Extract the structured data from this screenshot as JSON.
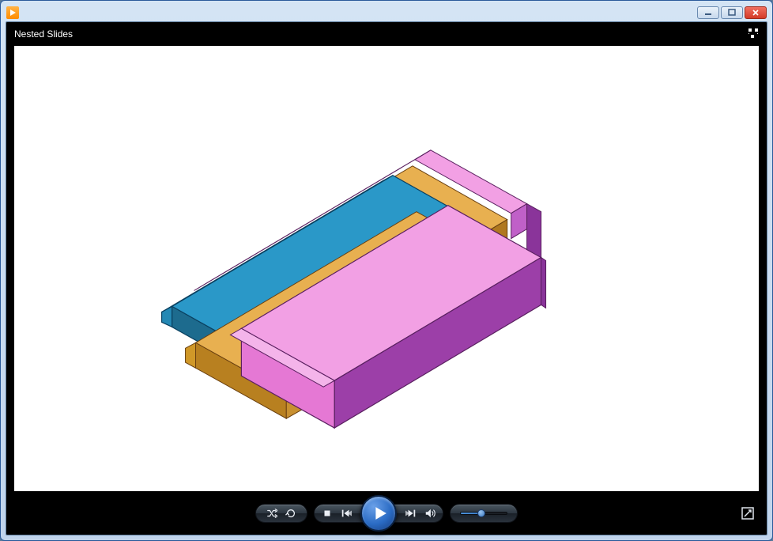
{
  "window": {
    "title": "",
    "controls": {
      "minimize": "Minimize",
      "maximize": "Maximize",
      "close": "Close"
    }
  },
  "player": {
    "video_title": "Nested Slides",
    "controls": {
      "shuffle": "Shuffle",
      "repeat": "Repeat",
      "stop": "Stop",
      "previous": "Previous",
      "play": "Play",
      "next": "Next",
      "mute": "Mute",
      "fullscreen": "View full screen"
    },
    "volume_percent": 45
  },
  "colors": {
    "titlebar_gradient_top": "#d4e4f4",
    "titlebar_gradient_bottom": "#c0d4ec",
    "player_bg": "#000000",
    "canvas_bg": "#ffffff",
    "model_pink": "#e578d4",
    "model_pink_dark": "#9c3fa8",
    "model_blue": "#2a98c8",
    "model_blue_dark": "#1d6b8e",
    "model_gold": "#d8a040",
    "model_gold_dark": "#a06a20",
    "play_button": "#2a6bc4"
  }
}
